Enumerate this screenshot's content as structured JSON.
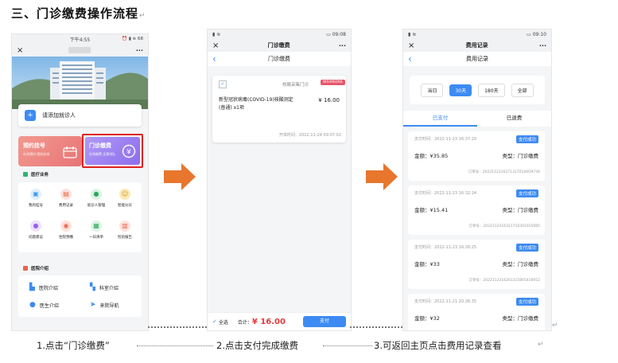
{
  "doc": {
    "heading": "三、门诊缴费操作流程",
    "para_mark": "↵"
  },
  "p1": {
    "time": "下午4:55",
    "status_icons": "⏰ ▮ ≋ 68",
    "close": "×",
    "more": "···",
    "add_patient_label": "请添加就诊人",
    "add_patient_icon": "+",
    "card_register_title": "预约挂号",
    "card_register_sub": "在线预约 提前安排",
    "card_pay_title": "门诊缴费",
    "card_pay_sub": "在线缴费 无需排队",
    "section_business": "医疗业务",
    "services": [
      "我的挂号",
      "费用记录",
      "就诊人管理",
      "智能分诊",
      "问题建议",
      "住院预缴",
      "一日清单",
      "检验报告"
    ],
    "section_intro": "医院介绍",
    "intro_items": [
      "医院介绍",
      "科室介绍",
      "医生介绍",
      "来院导航"
    ]
  },
  "p2": {
    "status_left": "▮ ≋",
    "status_right": "▭ 09:08",
    "title": "门诊缴费",
    "close": "×",
    "more": "···",
    "back": "‹",
    "subtitle": "门诊缴费",
    "dept": "核酸采集门诊",
    "badge": "W0490266",
    "item_name": "新型冠状病毒(COVID-19)核酸测定(普通) x1项",
    "item_price": "¥ 16.00",
    "order_time": "开单时间：2022-11-24 09:07:02",
    "select_all": "全选",
    "total_label": "合计：",
    "total_value": "¥ 16.00",
    "pay_button": "支付"
  },
  "p3": {
    "status_left": "▮ ≋",
    "status_right": "▭ 09:10",
    "title": "费用记录",
    "close": "×",
    "more": "···",
    "back": "‹",
    "subtitle": "费用记录",
    "filters": [
      "当日",
      "30天",
      "180天",
      "全部"
    ],
    "active_filter": "30天",
    "tabs": [
      "已支付",
      "已退费"
    ],
    "records": [
      {
        "time": "支付时间：2022-11-23 16:37:20",
        "status": "支付成功",
        "amount": "金额：¥35.85",
        "type": "类型：门诊缴费",
        "order": "订单号：20221123163713170184Ο9736"
      },
      {
        "time": "支付时间：2022-11-23 16:32:24",
        "status": "支付成功",
        "amount": "金额：¥15.41",
        "type": "类型：门诊缴费",
        "order": "订单号：20221123163217103019150​85"
      },
      {
        "time": "支付时间：2022-11-23 16:26:25",
        "status": "支付成功",
        "amount": "金额：¥33",
        "type": "类型：门诊缴费",
        "order": "订单号：20221123162613158054160​52"
      },
      {
        "time": "支付时间：2022-11-21 20:26:35",
        "status": "支付成功",
        "amount": "金额：¥32",
        "type": "类型：门诊缴费",
        "order": "订单号：2022112120263..."
      }
    ]
  },
  "captions": {
    "step1": "1.点击“门诊缴费”",
    "step2": "2.点击支付完成缴费",
    "step3": "3.可返回主页点击费用记录查看",
    "end_mark": "↵"
  },
  "colors": {
    "accent": "#3d8bf2",
    "arrow": "#e8762d",
    "price": "#e4393c",
    "register_card": "#ef7f80",
    "pay_card": "#9b7bf0",
    "highlight": "#e02020"
  }
}
